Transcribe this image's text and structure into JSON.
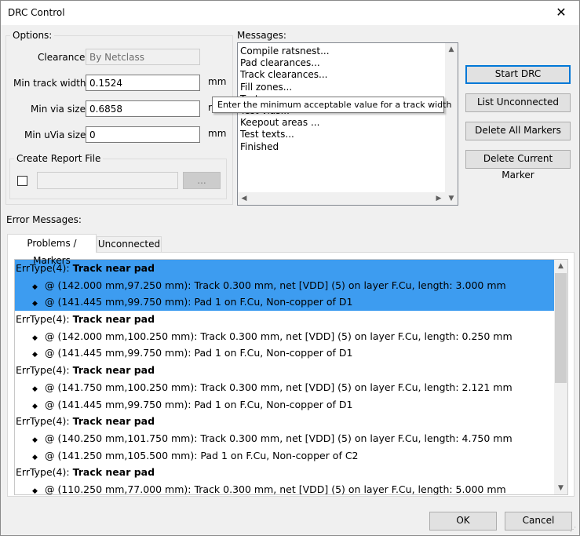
{
  "window": {
    "title": "DRC Control",
    "close_glyph": "✕"
  },
  "options": {
    "group_label": "Options:",
    "clearance_label": "Clearance",
    "clearance_value": "By Netclass",
    "min_track_label": "Min track width",
    "min_track_value": "0.1524",
    "min_via_label": "Min via size",
    "min_via_value": "0.6858",
    "min_uvia_label": "Min uVia size",
    "min_uvia_value": "0",
    "unit": "mm",
    "unit_partial": "r",
    "report_group_label": "Create Report File",
    "report_path_value": "",
    "browse_label": "..."
  },
  "messages": {
    "label": "Messages:",
    "lines": [
      "Compile ratsnest...",
      "Pad clearances...",
      "Track clearances...",
      "Fill zones...",
      "Test zones...",
      "Test vias...",
      "Keepout areas ...",
      "Test texts...",
      "Finished"
    ]
  },
  "tooltip": {
    "text": "Enter the minimum acceptable value for a track width"
  },
  "actions": {
    "start_drc": "Start DRC",
    "list_unconnected": "List Unconnected",
    "delete_all": "Delete All Markers",
    "delete_current": "Delete Current Marker"
  },
  "errors": {
    "label": "Error Messages:",
    "tabs": [
      "Problems / Markers",
      "Unconnected"
    ],
    "groups": [
      {
        "type": "ErrType(4):",
        "title": "Track near pad",
        "selected": true,
        "items": [
          "@ (142.000 mm,97.250 mm): Track 0.300 mm, net [VDD] (5) on layer F.Cu, length: 3.000 mm",
          "@ (141.445 mm,99.750 mm): Pad 1 on F.Cu, Non-copper of D1"
        ]
      },
      {
        "type": "ErrType(4):",
        "title": "Track near pad",
        "selected": false,
        "items": [
          "@ (142.000 mm,100.250 mm): Track 0.300 mm, net [VDD] (5) on layer F.Cu, length: 0.250 mm",
          "@ (141.445 mm,99.750 mm): Pad 1 on F.Cu, Non-copper of D1"
        ]
      },
      {
        "type": "ErrType(4):",
        "title": "Track near pad",
        "selected": false,
        "items": [
          "@ (141.750 mm,100.250 mm): Track 0.300 mm, net [VDD] (5) on layer F.Cu, length: 2.121 mm",
          "@ (141.445 mm,99.750 mm): Pad 1 on F.Cu, Non-copper of D1"
        ]
      },
      {
        "type": "ErrType(4):",
        "title": "Track near pad",
        "selected": false,
        "items": [
          "@ (140.250 mm,101.750 mm): Track 0.300 mm, net [VDD] (5) on layer F.Cu, length: 4.750 mm",
          "@ (141.250 mm,105.500 mm): Pad 1 on F.Cu, Non-copper of C2"
        ]
      },
      {
        "type": "ErrType(4):",
        "title": "Track near pad",
        "selected": false,
        "items": [
          "@ (110.250 mm,77.000 mm): Track 0.300 mm, net [VDD] (5) on layer F.Cu, length: 5.000 mm"
        ]
      }
    ]
  },
  "footer": {
    "ok": "OK",
    "cancel": "Cancel"
  },
  "colors": {
    "selection": "#3d9cf0",
    "default_button_border": "#0078d7"
  }
}
